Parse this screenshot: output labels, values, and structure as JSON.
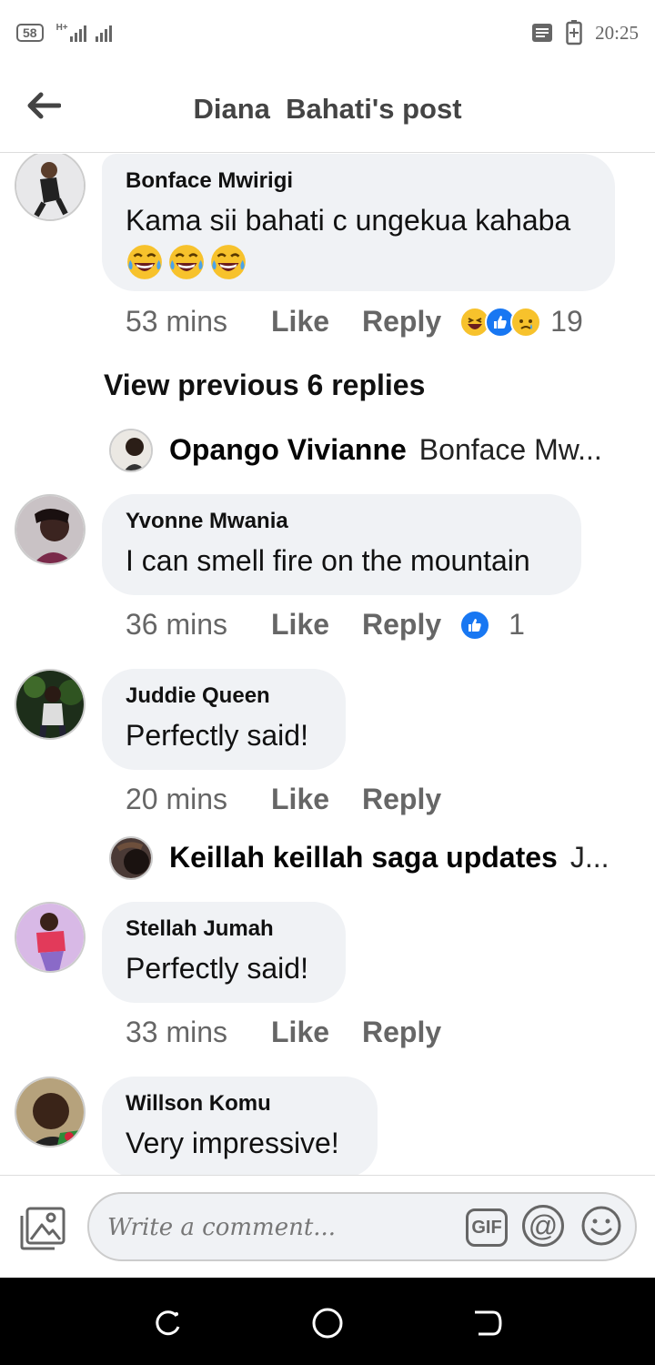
{
  "status_bar": {
    "sim": "58",
    "network": "H+",
    "time": "20:25"
  },
  "header": {
    "title": "Diana  Bahati's post"
  },
  "comments": [
    {
      "name": "Bonface Mwirigi",
      "text": "Kama sii bahati c ungekua kahaba",
      "emojis": [
        "laughing-tears",
        "laughing-tears",
        "laughing-tears"
      ],
      "time": "53 mins",
      "like": "Like",
      "reply": "Reply",
      "reactions": [
        "haha",
        "like",
        "sad"
      ],
      "reaction_count": "19"
    },
    {
      "name": "Yvonne Mwania",
      "text": "I can smell fire on the mountain",
      "time": "36 mins",
      "like": "Like",
      "reply": "Reply",
      "reactions": [
        "like"
      ],
      "reaction_count": "1"
    },
    {
      "name": "Juddie Queen",
      "text": "Perfectly said!",
      "time": "20 mins",
      "like": "Like",
      "reply": "Reply"
    },
    {
      "name": "Stellah Jumah",
      "text": "Perfectly said!",
      "time": "33 mins",
      "like": "Like",
      "reply": "Reply"
    },
    {
      "name": "Willson Komu",
      "text": "Very impressive!"
    }
  ],
  "view_previous": "View previous 6 replies",
  "reply_previews": [
    {
      "name": "Opango Vivianne",
      "text": "Bonface Mw..."
    },
    {
      "name": "Keillah keillah saga updates",
      "text": "J..."
    }
  ],
  "composer": {
    "placeholder": "Write a comment...",
    "gif_label": "GIF",
    "at_label": "@"
  },
  "colors": {
    "bubble": "#f0f2f5",
    "like_blue": "#1877f2",
    "secondary_text": "#666666"
  }
}
